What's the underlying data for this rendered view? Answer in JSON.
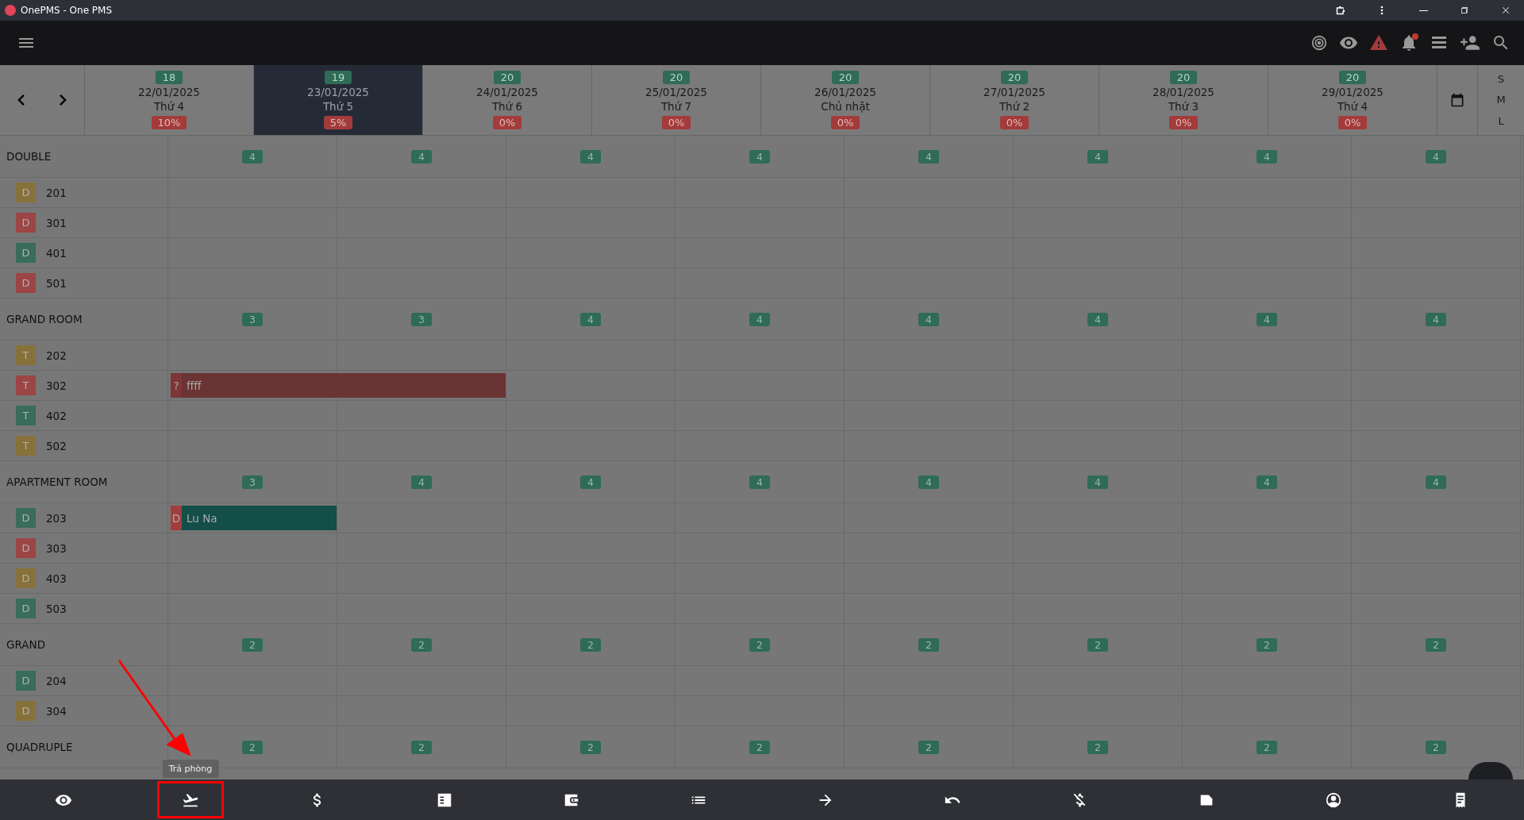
{
  "title_bar": {
    "title": "OnePMS - One PMS"
  },
  "date_header": {
    "days": [
      {
        "available": "18",
        "date": "22/01/2025",
        "weekday": "Thứ 4",
        "occupancy": "10%",
        "selected": false
      },
      {
        "available": "19",
        "date": "23/01/2025",
        "weekday": "Thứ 5",
        "occupancy": "5%",
        "selected": true
      },
      {
        "available": "20",
        "date": "24/01/2025",
        "weekday": "Thứ 6",
        "occupancy": "0%",
        "selected": false
      },
      {
        "available": "20",
        "date": "25/01/2025",
        "weekday": "Thứ 7",
        "occupancy": "0%",
        "selected": false
      },
      {
        "available": "20",
        "date": "26/01/2025",
        "weekday": "Chủ nhật",
        "occupancy": "0%",
        "selected": false
      },
      {
        "available": "20",
        "date": "27/01/2025",
        "weekday": "Thứ 2",
        "occupancy": "0%",
        "selected": false
      },
      {
        "available": "20",
        "date": "28/01/2025",
        "weekday": "Thứ 3",
        "occupancy": "0%",
        "selected": false
      },
      {
        "available": "20",
        "date": "29/01/2025",
        "weekday": "Thứ 4",
        "occupancy": "0%",
        "selected": false
      }
    ]
  },
  "view_sizes": [
    {
      "label": "S"
    },
    {
      "label": "M"
    },
    {
      "label": "L"
    }
  ],
  "room_groups": [
    {
      "name": "DOUBLE",
      "counts": [
        "4",
        "4",
        "4",
        "4",
        "4",
        "4",
        "4",
        "4"
      ],
      "rooms": [
        {
          "badge": "D",
          "number": "201",
          "color": "#8a7130"
        },
        {
          "badge": "D",
          "number": "301",
          "color": "#a33d3d"
        },
        {
          "badge": "D",
          "number": "401",
          "color": "#2f6b56"
        },
        {
          "badge": "D",
          "number": "501",
          "color": "#a33d3d"
        }
      ]
    },
    {
      "name": "GRAND ROOM",
      "counts": [
        "3",
        "3",
        "4",
        "4",
        "4",
        "4",
        "4",
        "4"
      ],
      "rooms": [
        {
          "badge": "T",
          "number": "202",
          "color": "#8a7130"
        },
        {
          "badge": "T",
          "number": "302",
          "color": "#a33d3d",
          "cells": [
            {
              "kind": "booked"
            },
            {
              "kind": "booked"
            },
            {
              "kind": "free"
            },
            {
              "kind": "free"
            },
            {
              "kind": "free"
            },
            {
              "kind": "free"
            },
            {
              "kind": "free"
            },
            {
              "kind": "free"
            }
          ],
          "booking": {
            "marker": {
              "label": "?",
              "color": "#7e3535"
            },
            "guest": "ffff",
            "color": "#6b3434"
          }
        },
        {
          "badge": "T",
          "number": "402",
          "color": "#2f6b56"
        },
        {
          "badge": "T",
          "number": "502",
          "color": "#8a7130"
        }
      ]
    },
    {
      "name": "APARTMENT ROOM",
      "counts": [
        "3",
        "4",
        "4",
        "4",
        "4",
        "4",
        "4",
        "4"
      ],
      "rooms": [
        {
          "badge": "D",
          "number": "203",
          "color": "#2f6b56",
          "cells": [
            {
              "kind": "booked"
            },
            {
              "kind": "free"
            },
            {
              "kind": "free"
            },
            {
              "kind": "free"
            },
            {
              "kind": "free"
            },
            {
              "kind": "free"
            },
            {
              "kind": "free"
            },
            {
              "kind": "free"
            }
          ],
          "booking": {
            "marker": {
              "label": "D",
              "color": "#a33d3d"
            },
            "guest": "Lu Na",
            "color": "#134e49"
          }
        },
        {
          "badge": "D",
          "number": "303",
          "color": "#a33d3d"
        },
        {
          "badge": "D",
          "number": "403",
          "color": "#8a7130"
        },
        {
          "badge": "D",
          "number": "503",
          "color": "#2f6b56"
        }
      ]
    },
    {
      "name": "GRAND",
      "counts": [
        "2",
        "2",
        "2",
        "2",
        "2",
        "2",
        "2",
        "2"
      ],
      "rooms": [
        {
          "badge": "D",
          "number": "204",
          "color": "#2f6b56"
        },
        {
          "badge": "D",
          "number": "304",
          "color": "#8a7130"
        }
      ]
    },
    {
      "name": "QUADRUPLE",
      "counts": [
        "2",
        "2",
        "2",
        "2",
        "2",
        "2",
        "2",
        "2"
      ]
    }
  ],
  "bottom_bar": {
    "tooltip": "Trả phòng",
    "buttons": [
      {
        "kind": "eye",
        "highlighted": false
      },
      {
        "kind": "departure",
        "highlighted": true
      },
      {
        "kind": "dollar",
        "highlighted": false
      },
      {
        "kind": "checklist",
        "highlighted": false
      },
      {
        "kind": "wallet",
        "highlighted": false
      },
      {
        "kind": "list",
        "highlighted": false
      },
      {
        "kind": "arrow",
        "highlighted": false
      },
      {
        "kind": "undo",
        "highlighted": false
      },
      {
        "kind": "money-off",
        "highlighted": false
      },
      {
        "kind": "label",
        "highlighted": false
      },
      {
        "kind": "account",
        "highlighted": false
      },
      {
        "kind": "receipt",
        "highlighted": false
      }
    ]
  }
}
